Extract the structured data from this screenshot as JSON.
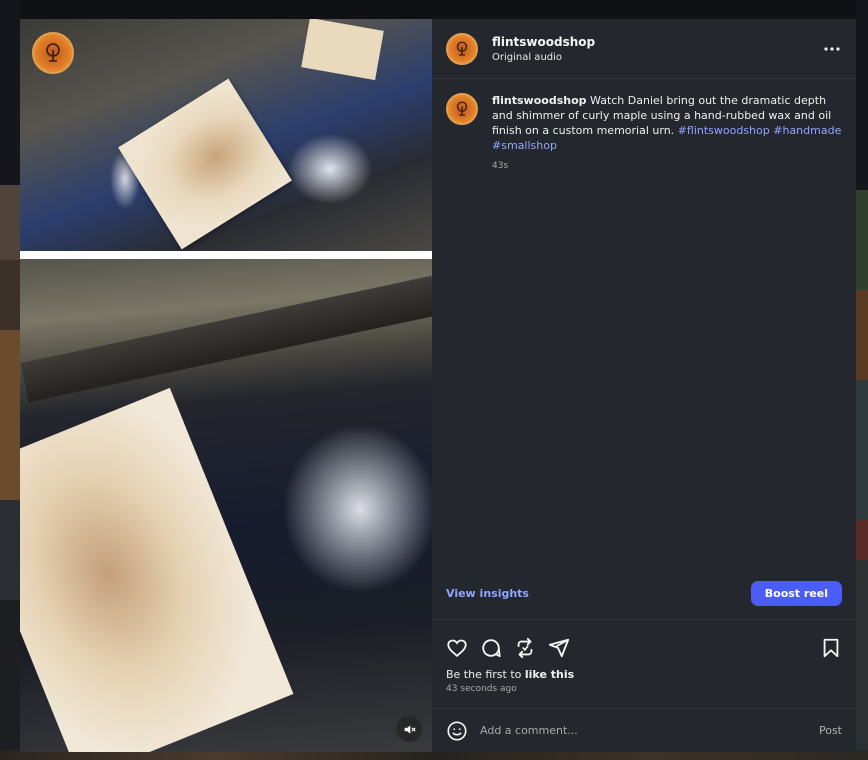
{
  "post": {
    "username": "flintswoodshop",
    "audio": "Original audio",
    "caption_user": "flintswoodshop",
    "caption_text": "Watch Daniel bring out the dramatic depth and shimmer of curly maple using a hand-rubbed wax and oil finish on a custom memorial urn.",
    "hashtags": [
      "#flintswoodshop",
      "#handmade",
      "#smallshop"
    ],
    "caption_time": "43s"
  },
  "insights": {
    "view_label": "View insights",
    "boost_label": "Boost reel"
  },
  "likes": {
    "prefix": "Be the first to ",
    "action": "like this"
  },
  "timestamp": "43 seconds ago",
  "comment": {
    "placeholder": "Add a comment...",
    "post_label": "Post"
  },
  "icons": {
    "more": "more-options-icon",
    "like": "heart-icon",
    "comment": "comment-icon",
    "repost": "repost-icon",
    "share": "send-icon",
    "save": "bookmark-icon",
    "emoji": "emoji-icon",
    "mute": "muted-speaker-icon"
  },
  "colors": {
    "panel_bg": "#25272f",
    "accent": "#4a5df9",
    "link": "#8fa6ff"
  }
}
